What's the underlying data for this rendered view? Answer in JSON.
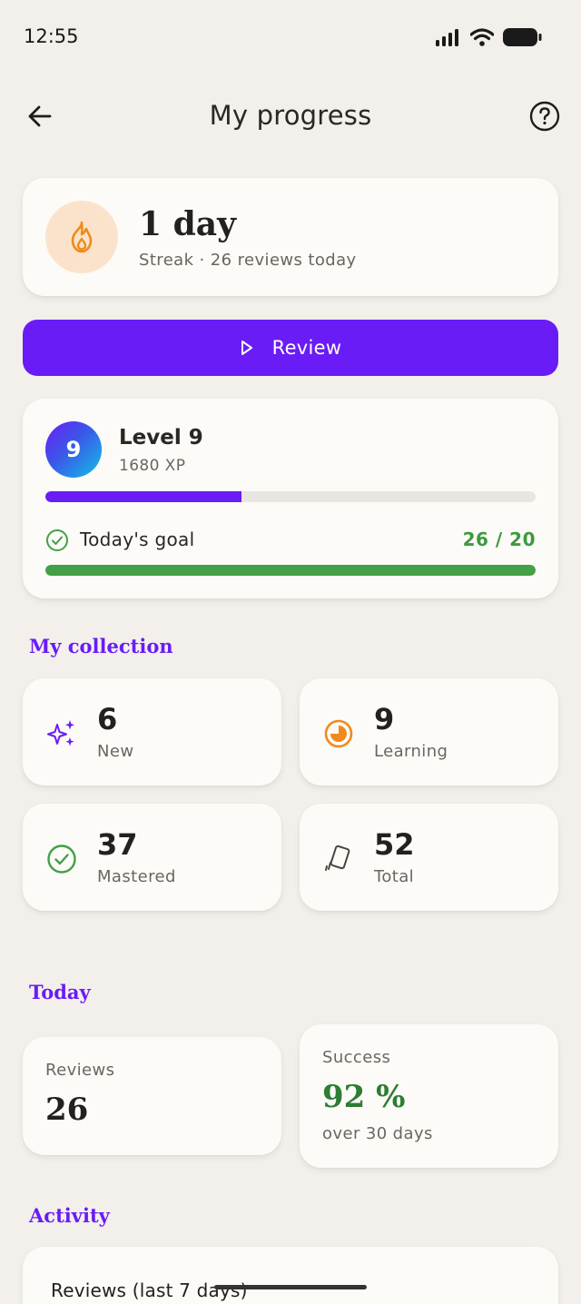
{
  "status_bar": {
    "time": "12:55"
  },
  "header": {
    "title": "My progress"
  },
  "streak": {
    "value": "1 day",
    "subtitle": "Streak · 26 reviews today"
  },
  "review_button": {
    "label": "Review"
  },
  "level": {
    "badge": "9",
    "title": "Level 9",
    "xp": "1680 XP",
    "xp_progress": 0.4,
    "goal_label": "Today's goal",
    "goal_value": "26 / 20",
    "goal_progress": 1.0
  },
  "collection": {
    "title": "My collection",
    "stats": [
      {
        "value": "6",
        "label": "New",
        "icon": "sparkle-icon"
      },
      {
        "value": "9",
        "label": "Learning",
        "icon": "pie-progress-icon"
      },
      {
        "value": "37",
        "label": "Mastered",
        "icon": "check-circle-icon"
      },
      {
        "value": "52",
        "label": "Total",
        "icon": "cards-icon"
      }
    ]
  },
  "today": {
    "title": "Today",
    "reviews_label": "Reviews",
    "reviews_value": "26",
    "success_label": "Success",
    "success_value": "92 %",
    "success_sub": "over 30 days"
  },
  "activity": {
    "title": "Activity",
    "card_title": "Reviews (last 7 days)"
  },
  "colors": {
    "accent": "#6a1cf6",
    "success": "#43a047",
    "streak_orange": "#f08a1c",
    "background": "#f3f0eb"
  }
}
